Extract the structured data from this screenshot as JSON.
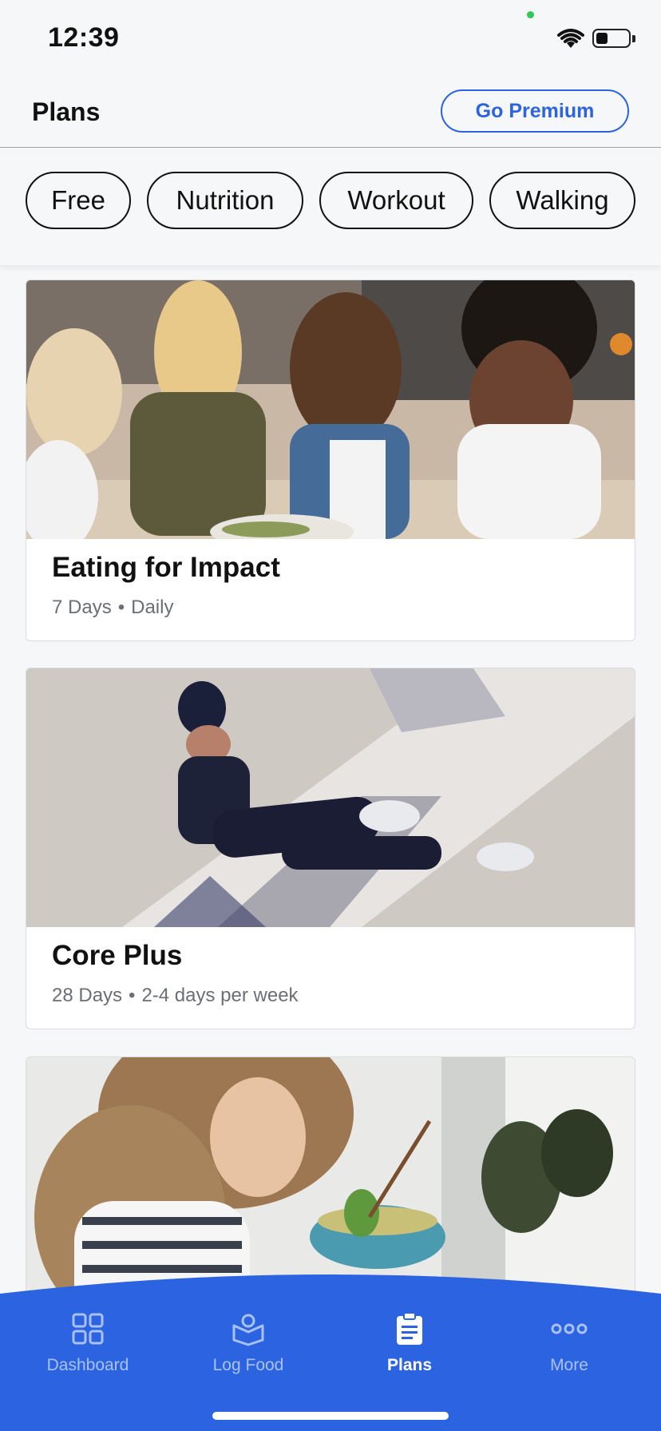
{
  "status_bar": {
    "time": "12:39"
  },
  "header": {
    "title": "Plans",
    "premium_label": "Go Premium"
  },
  "filters": [
    "Free",
    "Nutrition",
    "Workout",
    "Walking"
  ],
  "plans": [
    {
      "title": "Eating for Impact",
      "duration": "7 Days",
      "frequency": "Daily"
    },
    {
      "title": "Core Plus",
      "duration": "28 Days",
      "frequency": "2-4 days per week"
    }
  ],
  "nav": {
    "items": [
      {
        "label": "Dashboard",
        "icon": "dashboard-icon"
      },
      {
        "label": "Log Food",
        "icon": "log-food-icon"
      },
      {
        "label": "Plans",
        "icon": "plans-icon"
      },
      {
        "label": "More",
        "icon": "more-icon"
      }
    ],
    "active": "Plans"
  },
  "colors": {
    "accent": "#2b63e0",
    "nav_bg": "#2b63e0",
    "background": "#f6f7f8"
  }
}
